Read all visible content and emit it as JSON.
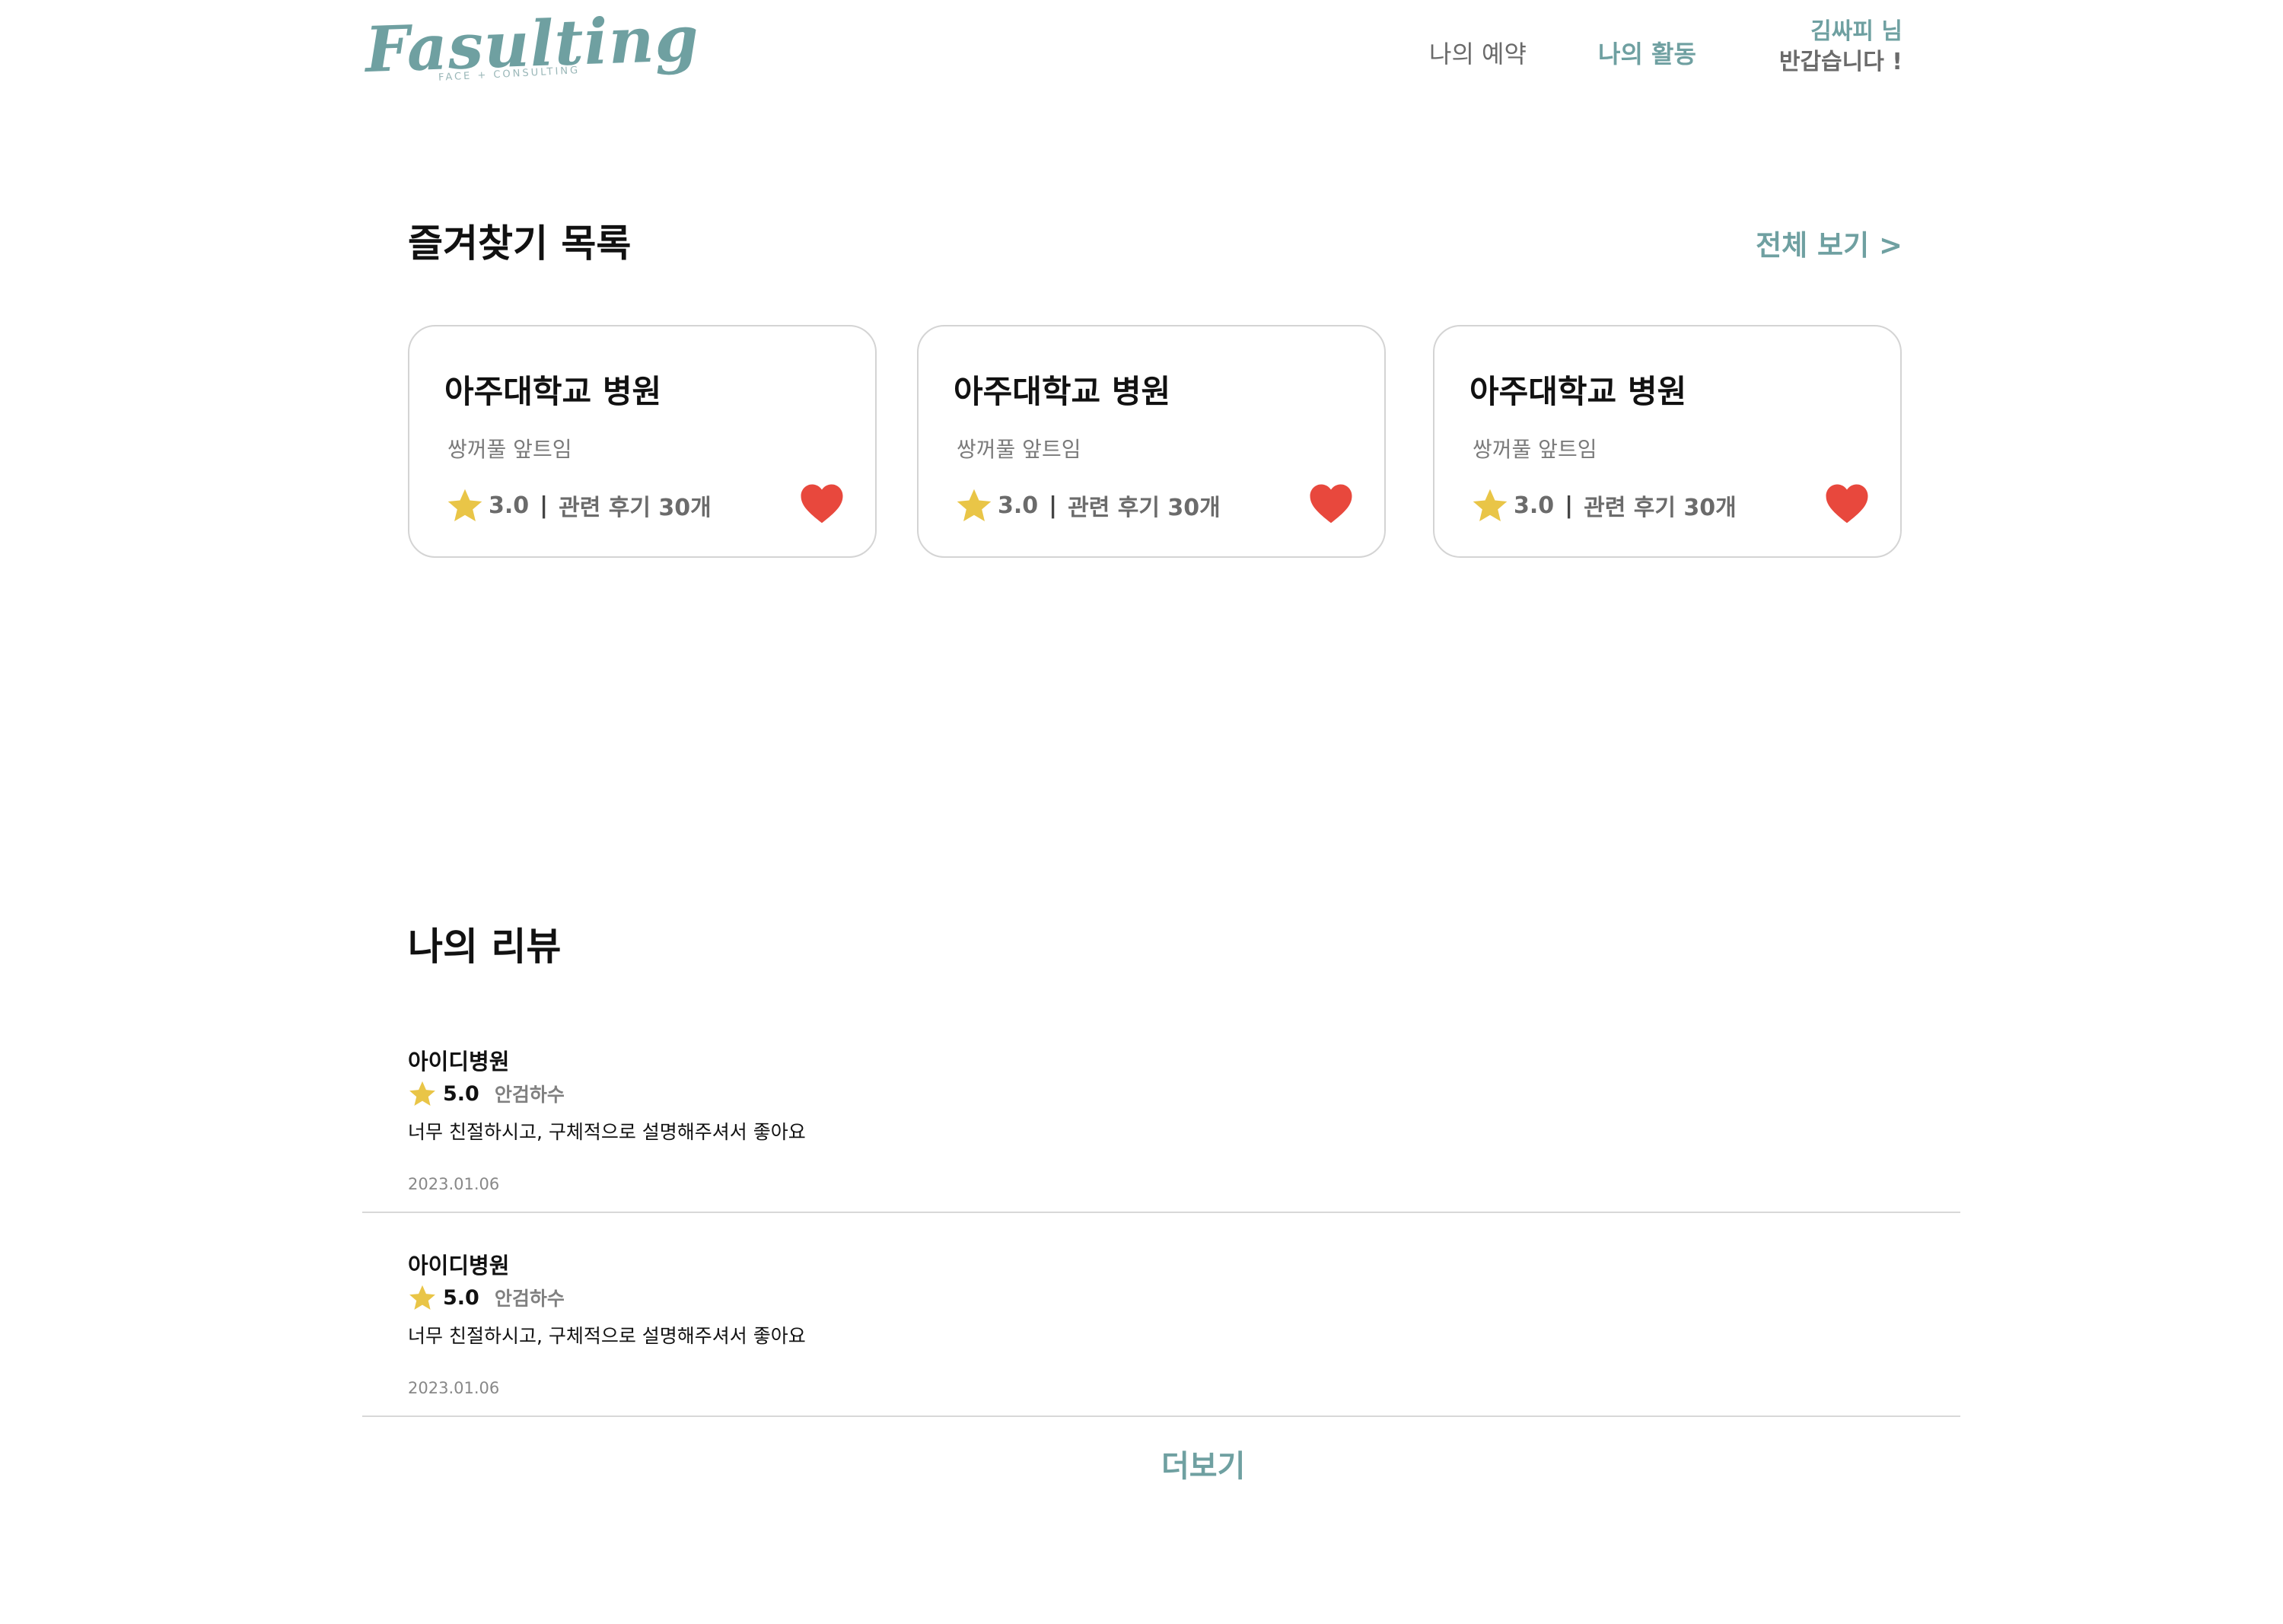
{
  "header": {
    "logo_text": "Fasulting",
    "logo_subtext": "FACE + CONSULTING",
    "nav": {
      "reservation": "나의 예약",
      "activity": "나의 활동"
    },
    "greeting": {
      "name_line": "김싸피 님",
      "welcome_line": "반갑습니다 !"
    }
  },
  "favorites": {
    "title": "즐겨찾기 목록",
    "see_all": "전체 보기 >",
    "cards": [
      {
        "name": "아주대학교 병원",
        "desc": "쌍꺼풀 앞트임",
        "rating": "3.0",
        "sep": "|",
        "reviews": "관련 후기 30개"
      },
      {
        "name": "아주대학교 병원",
        "desc": "쌍꺼풀 앞트임",
        "rating": "3.0",
        "sep": "|",
        "reviews": "관련 후기 30개"
      },
      {
        "name": "아주대학교 병원",
        "desc": "쌍꺼풀 앞트임",
        "rating": "3.0",
        "sep": "|",
        "reviews": "관련 후기 30개"
      }
    ]
  },
  "reviews": {
    "title": "나의 리뷰",
    "items": [
      {
        "hospital": "아이디병원",
        "score": "5.0",
        "procedure": "안검하수",
        "text": "너무 친절하시고, 구체적으로 설명해주셔서 좋아요",
        "date": "2023.01.06"
      },
      {
        "hospital": "아이디병원",
        "score": "5.0",
        "procedure": "안검하수",
        "text": "너무 친절하시고, 구체적으로 설명해주셔서 좋아요",
        "date": "2023.01.06"
      }
    ],
    "more": "더보기"
  },
  "colors": {
    "accent": "#6fa0a1",
    "star": "#e9c547",
    "heart": "#e8483d"
  },
  "icons": {
    "star": "star-icon",
    "heart": "heart-icon"
  }
}
